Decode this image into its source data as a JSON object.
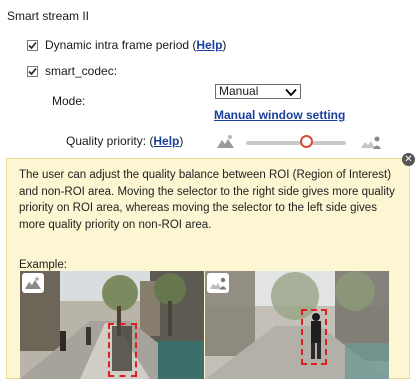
{
  "section_title": "Smart stream II",
  "dynamic_intra": {
    "checked": true,
    "label": "Dynamic intra frame period (",
    "help_label": "Help",
    "suffix": ")"
  },
  "smart_codec": {
    "checked": true,
    "label": "smart_codec:"
  },
  "mode": {
    "label": "Mode:",
    "selected": "Manual"
  },
  "manual_window_link": "Manual window setting",
  "quality_priority": {
    "label": "Quality priority: (",
    "help_label": "Help",
    "suffix": ")",
    "slider_value": 0.6
  },
  "tip": {
    "text": "The user can adjust the quality balance between ROI (Region of Interest) and non-ROI area. Moving the selector to the right side gives more quality priority on ROI area, whereas moving the selector to the left side gives more quality priority on non-ROI area.",
    "example_label": "Example:"
  },
  "icons": {
    "close": "close-icon",
    "non_roi_quality": "landscape-quality-icon",
    "roi_quality": "person-quality-icon",
    "dropdown": "chevron-down-icon"
  },
  "colors": {
    "link": "#1a3f9c",
    "tip_background": "#fdf6d3",
    "roi_outline": "#e02020",
    "slider_thumb": "#d94b3a"
  }
}
